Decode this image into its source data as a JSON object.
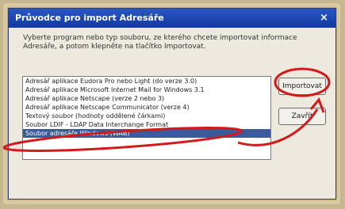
{
  "window": {
    "title": "Průvodce pro import Adresáře",
    "close_glyph": "×"
  },
  "description": "Vyberte program nebo typ souboru, ze kterého chcete importovat informace Adresáře, a potom klepněte na tlačítko Importovat.",
  "list": {
    "items": [
      "Adresář aplikace Eudora Pro nebo Light (do verze 3.0)",
      "Adresář aplikace Microsoft Internet Mail for Windows 3.1",
      "Adresář aplikace Netscape (verze 2 nebo 3)",
      "Adresář aplikace Netscape Communicator (verze 4)",
      "Textový soubor (hodnoty oddělené čárkami)",
      "Soubor LDIF - LDAP Data Interchange Format",
      "Soubor adresáře Windows (WAB)"
    ],
    "selected_index": 6
  },
  "buttons": {
    "import": "Importovat",
    "close": "Zavřít"
  },
  "annotation_color": "#d21a1a"
}
